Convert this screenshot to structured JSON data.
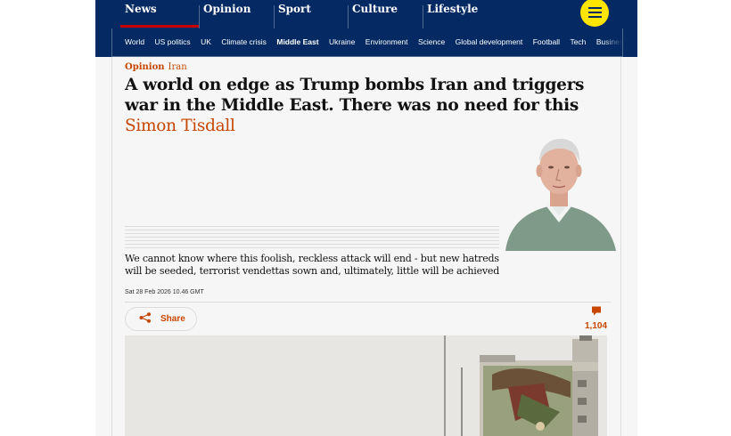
{
  "pillars": {
    "items": [
      {
        "label": "News"
      },
      {
        "label": "Opinion"
      },
      {
        "label": "Sport"
      },
      {
        "label": "Culture"
      },
      {
        "label": "Lifestyle"
      }
    ],
    "active": "News"
  },
  "subnav": {
    "items": [
      "World",
      "US politics",
      "UK",
      "Climate crisis",
      "Middle East",
      "Ukraine",
      "Environment",
      "Science",
      "Global development",
      "Football",
      "Tech",
      "Business"
    ],
    "active": "Middle East"
  },
  "article": {
    "kicker_section": "Opinion",
    "kicker_tag": "Iran",
    "headline": "A world on edge as Trump bombs Iran and triggers war in the Middle East. There was no need for this",
    "byline": "Simon Tisdall",
    "standfirst": "We cannot know where this foolish, reckless attack will end - but new hatreds will be seeded, terrorist vendettas sown and, ultimately, little will be achieved",
    "date": "Sat 28 Feb 2026 10.46 GMT",
    "share_label": "Share",
    "comment_count": "1,104"
  },
  "colors": {
    "brand_dark": "#052962",
    "accent": "#c74600",
    "menu_button": "#ffe500",
    "active_pillar_bar": "#c70000"
  },
  "icons": {
    "menu": "hamburger-icon",
    "share": "share-icon",
    "comments": "comment-icon"
  }
}
